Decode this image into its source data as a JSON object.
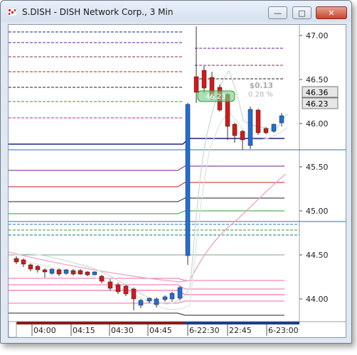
{
  "window": {
    "title": "S.DISH - DISH Network Corp., 3 Min",
    "min_label": "—",
    "max_label": "□",
    "close_label": "✕"
  },
  "price_axis": {
    "ticks": [
      "47.00",
      "46.50",
      "46.00",
      "45.50",
      "45.00",
      "44.50",
      "44.00"
    ],
    "last_price_tag": "46.36",
    "bid_tag": "46.23"
  },
  "time_axis": {
    "labels": [
      "04:00",
      "04:15",
      "04:30",
      "04:45",
      "6-22:30",
      "22:45",
      "6-23:00"
    ]
  },
  "overlay": {
    "change": "$0.13",
    "change_pct": "0.28 %",
    "price_box": "46.23"
  },
  "colors": {
    "up_candle": "#1f6fd6",
    "down_candle": "#d11a1a",
    "axis_tag_bg": "#ececec",
    "window_chrome": "#dfe8f3"
  }
}
